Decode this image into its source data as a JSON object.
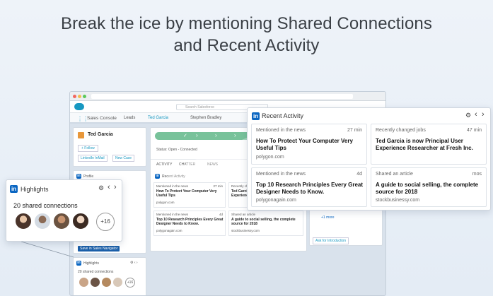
{
  "headline": {
    "line1": "Break the ice by mentioning Shared Connections",
    "line2": "and Recent Activity"
  },
  "colors": {
    "linkedin_blue": "#0a66c2",
    "salesforce_blue": "#1798c1",
    "path_green": "#78c29a"
  },
  "background_app": {
    "search_placeholder": "Search Salesforce",
    "nav": {
      "app_name": "Sales Console",
      "leads": "Leads",
      "tab1": "Ted Garcia",
      "tab2": "Stephen Bradley"
    },
    "contact": {
      "name": "Ted Garcia",
      "follow": "+ Follow",
      "inmail": "LinkedIn InMail",
      "new_case": "New Case"
    },
    "status": "Status: Open - Connected",
    "tabs": [
      "ACTIVITY",
      "CHATTER",
      "NEWS"
    ],
    "profile_label": "Profile",
    "recent_activity_label": "Recent Activity",
    "mini_tiles": [
      {
        "type": "Mentioned in the news",
        "time": "27 min",
        "headline": "How To Protect Your Computer Very Useful Tips",
        "source": "polygon.com"
      },
      {
        "type": "Recently changed jobs",
        "time": "",
        "headline": "Ted Garcia is now Principal User Experience Researcher at Fresh Inc.",
        "source": ""
      },
      {
        "type": "Mentioned in the news",
        "time": "4d",
        "headline": "Top 10 Research Principles Every Great Designer Needs to Know.",
        "source": "polygonagain.com"
      },
      {
        "type": "Shared an article",
        "time": "",
        "headline": "A guide to social selling, the complete source for 2018",
        "source": "stockbusinessy.com"
      }
    ],
    "save_button": "Save in Sales Navigator",
    "add_intro": "Ask for Introduction",
    "more_link": "+1 more",
    "highlights_label": "Highlights",
    "shared_connections": "20 shared connections",
    "more_count": "+16"
  },
  "recent_activity": {
    "title": "Recent Activity",
    "tiles": [
      {
        "type": "Mentioned in the news",
        "time": "27 min",
        "headline": "How To Protect Your Computer Very Useful Tips",
        "source": "polygon.com"
      },
      {
        "type": "Recently changed jobs",
        "time": "47 min",
        "headline": "Ted Garcia is now Principal User Experience Researcher at Fresh Inc.",
        "source": ""
      },
      {
        "type": "Mentioned in the news",
        "time": "4d",
        "headline": "Top 10 Research Principles Every Great Designer Needs to Know.",
        "source": "polygonagain.com"
      },
      {
        "type": "Shared an article",
        "time": "mos",
        "headline": "A guide to social selling, the complete source for 2018",
        "source": "stockbusinessy.com"
      }
    ]
  },
  "highlights": {
    "title": "Highlights",
    "shared_connections": "20 shared connections",
    "more_count": "+16"
  },
  "icons": {
    "linkedin": "in",
    "settings": "⚙",
    "prev": "‹",
    "next": "›"
  }
}
